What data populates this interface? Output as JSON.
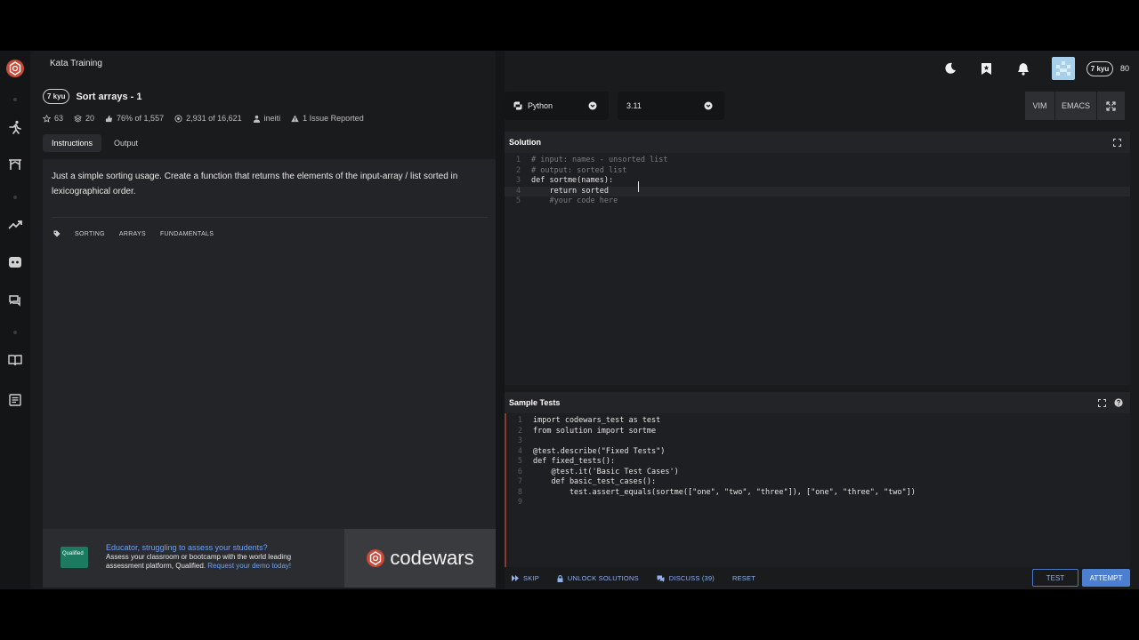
{
  "topbar": {
    "title": "Kata Training",
    "user_rank": "7 kyu",
    "honor": "80"
  },
  "kata": {
    "rank": "7 kyu",
    "title": "Sort arrays - 1",
    "stats": {
      "stars": "63",
      "collections": "20",
      "satisfaction": "76% of 1,557",
      "completions": "2,931 of 16,621",
      "author": "ineiti",
      "issues": "1 Issue Reported"
    },
    "tabs": [
      "Instructions",
      "Output"
    ],
    "description": "Just a simple sorting usage. Create a function that returns the elements of the input-array / list sorted in lexicographical order.",
    "tags": [
      "SORTING",
      "ARRAYS",
      "FUNDAMENTALS"
    ]
  },
  "ad": {
    "logo_text": "Qualified",
    "headline": "Educator, struggling to assess your students?",
    "body": "Assess your classroom or bootcamp with the world leading assessment platform, Qualified. ",
    "link": "Request your demo today!",
    "brand": "codewars"
  },
  "editor": {
    "language": "Python",
    "version": "3.11",
    "modes": [
      "VIM",
      "EMACS"
    ],
    "solution_title": "Solution",
    "solution_lines": [
      "# input: names - unsorted list",
      "# output: sorted list",
      "def sortme(names):",
      "    return sorted",
      "    #your code here"
    ],
    "tests_title": "Sample Tests",
    "test_lines": [
      "import codewars_test as test",
      "from solution import sortme",
      "",
      "@test.describe(\"Fixed Tests\")",
      "def fixed_tests():",
      "    @test.it('Basic Test Cases')",
      "    def basic_test_cases():",
      "        test.assert_equals(sortme([\"one\", \"two\", \"three\"]), [\"one\", \"three\", \"two\"])",
      ""
    ]
  },
  "actions": {
    "skip": "SKIP",
    "unlock": "UNLOCK SOLUTIONS",
    "discuss": "DISCUSS (39)",
    "reset": "RESET",
    "test": "TEST",
    "attempt": "ATTEMPT"
  },
  "colors": {
    "brand_red": "#c84b3a",
    "accent_blue": "#4d7fd1",
    "link_blue": "#6fa1f0"
  }
}
